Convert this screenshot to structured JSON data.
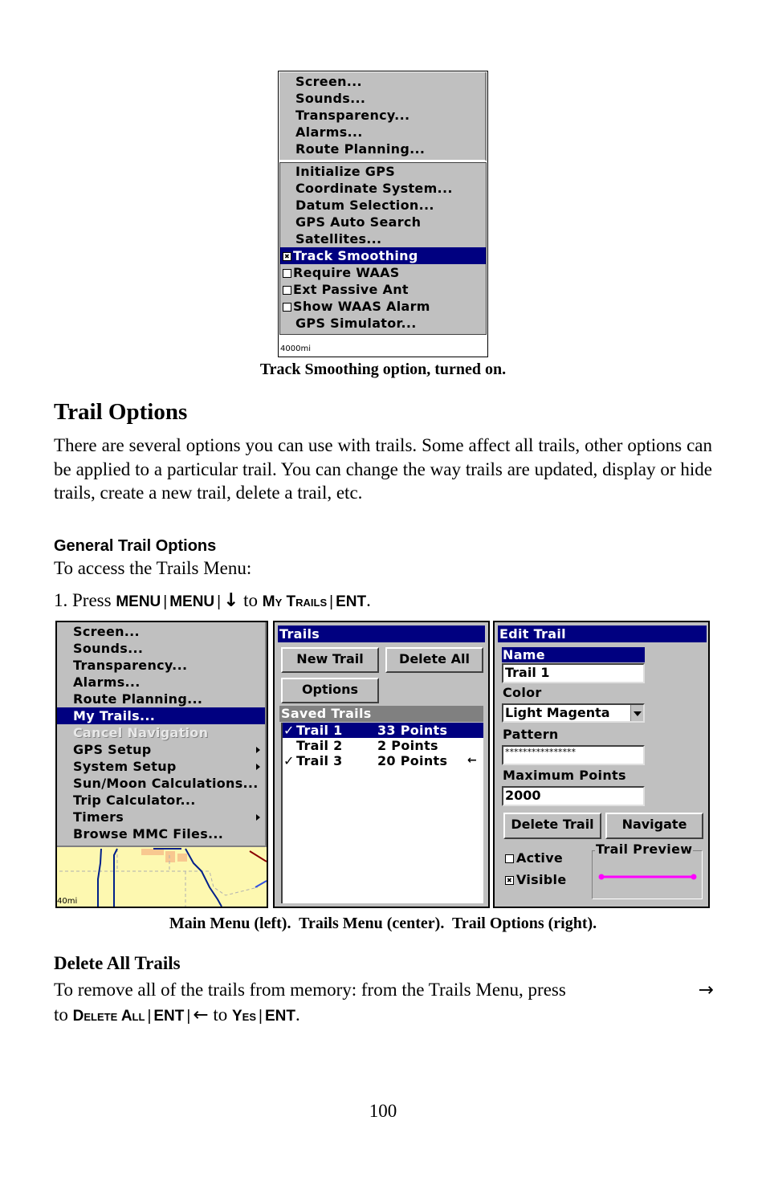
{
  "figure1": {
    "menu_top": [
      "Screen...",
      "Sounds...",
      "Transparency...",
      "Alarms...",
      "Route Planning..."
    ],
    "menu_gps": [
      {
        "label": "Initialize GPS",
        "checkbox": null,
        "selected": false
      },
      {
        "label": "Coordinate System...",
        "checkbox": null,
        "selected": false
      },
      {
        "label": "Datum Selection...",
        "checkbox": null,
        "selected": false
      },
      {
        "label": "GPS Auto Search",
        "checkbox": null,
        "selected": false
      },
      {
        "label": "Satellites...",
        "checkbox": null,
        "selected": false
      },
      {
        "label": "Track Smoothing",
        "checkbox": true,
        "selected": true
      },
      {
        "label": "Require WAAS",
        "checkbox": false,
        "selected": false
      },
      {
        "label": "Ext Passive Ant",
        "checkbox": false,
        "selected": false
      },
      {
        "label": "Show WAAS Alarm",
        "checkbox": false,
        "selected": false
      },
      {
        "label": "GPS Simulator...",
        "checkbox": null,
        "selected": false
      }
    ],
    "scale_label": "4000mi",
    "caption": "Track Smoothing option, turned on."
  },
  "section": {
    "title": "Trail Options",
    "intro": "There are several options you can use with trails. Some affect all trails, other options can be applied to a particular trail. You can change the way trails are updated, display or hide trails, create a new trail, delete a trail, etc.",
    "subheading": "General Trail Options",
    "access_text": "To access the Trails Menu:",
    "step1": {
      "prefix": "1. Press ",
      "key1": "MENU",
      "sep": "|",
      "key2": "MENU",
      "down_arrow": "↓",
      "to": " to ",
      "key3": "My Trails",
      "key4": "ENT",
      "end": "."
    }
  },
  "figure2": {
    "main_menu": {
      "items": [
        {
          "label": "Screen...",
          "state": "normal",
          "submenu": false
        },
        {
          "label": "Sounds...",
          "state": "normal",
          "submenu": false
        },
        {
          "label": "Transparency...",
          "state": "normal",
          "submenu": false
        },
        {
          "label": "Alarms...",
          "state": "normal",
          "submenu": false
        },
        {
          "label": "Route Planning...",
          "state": "normal",
          "submenu": false
        },
        {
          "label": "My Trails...",
          "state": "selected",
          "submenu": false
        },
        {
          "label": "Cancel Navigation",
          "state": "disabled",
          "submenu": false
        },
        {
          "label": "GPS Setup",
          "state": "normal",
          "submenu": true
        },
        {
          "label": "System Setup",
          "state": "normal",
          "submenu": true
        },
        {
          "label": "Sun/Moon Calculations...",
          "state": "normal",
          "submenu": false
        },
        {
          "label": "Trip Calculator...",
          "state": "normal",
          "submenu": false
        },
        {
          "label": "Timers",
          "state": "normal",
          "submenu": true
        },
        {
          "label": "Browse MMC Files...",
          "state": "normal",
          "submenu": false
        }
      ],
      "scale_label": "40mi"
    },
    "trails_menu": {
      "title": "Trails",
      "new_trail": "New Trail",
      "delete_all": "Delete All",
      "options": "Options",
      "saved_header": "Saved Trails",
      "trails": [
        {
          "name": "Trail 1",
          "points": "33 Points",
          "checked": true,
          "selected": true,
          "current": false
        },
        {
          "name": "Trail 2",
          "points": "2 Points",
          "checked": false,
          "selected": false,
          "current": false
        },
        {
          "name": "Trail 3",
          "points": "20 Points",
          "checked": true,
          "selected": false,
          "current": true
        }
      ]
    },
    "edit_trail": {
      "title": "Edit Trail",
      "name_label": "Name",
      "name_value": "Trail 1",
      "color_label": "Color",
      "color_value": "Light Magenta",
      "pattern_label": "Pattern",
      "pattern_value": "****************",
      "max_points_label": "Maximum Points",
      "max_points_value": "2000",
      "delete_trail": "Delete Trail",
      "navigate": "Navigate",
      "active_label": "Active",
      "active_checked": false,
      "visible_label": "Visible",
      "visible_checked": true,
      "preview_label": "Trail Preview",
      "preview_color": "#ff00ff"
    },
    "caption": "Main Menu (left).  Trails Menu (center).  Trail Options (right)."
  },
  "delete_all_section": {
    "heading": "Delete All Trails",
    "text1": "To remove all of the trails from memory: from the Trails Menu, press ",
    "right_arrow": "→",
    "to1": "to ",
    "key1": "Delete All",
    "sep": "|",
    "key2": "ENT",
    "left_arrow": "←",
    "to2": " to ",
    "key3": "Yes",
    "key4": "ENT",
    "end": "."
  },
  "page_number": "100",
  "colors": {
    "selection": "#000080",
    "menu_gray": "#c0c0c0",
    "map_yellow": "#fdf8b0",
    "road_blue": "#00208a",
    "trail_magenta": "#ff00ff"
  }
}
